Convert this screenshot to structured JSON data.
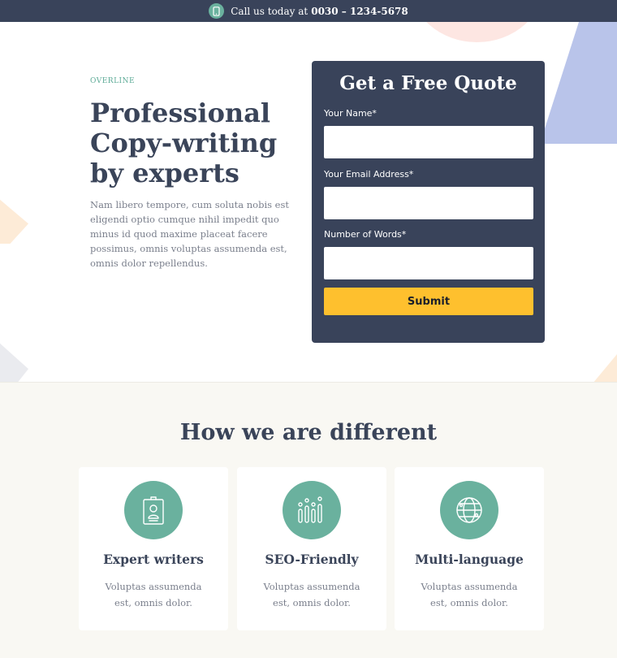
{
  "topbar": {
    "call_text": "Call us today at",
    "phone_number": "0030 – 1234-5678",
    "icon": "phone-icon"
  },
  "hero": {
    "overline": "OVERLINE",
    "title": "Professional Copy-writing by experts",
    "text": "Nam libero tempore, cum soluta nobis est eligendi optio cumque nihil impedit quo minus id quod maxime placeat facere possimus, omnis voluptas assumenda est, omnis dolor repellendus."
  },
  "quote_form": {
    "title": "Get a Free Quote",
    "fields": [
      {
        "label": "Your Name*",
        "value": "",
        "placeholder": ""
      },
      {
        "label": "Your Email Address*",
        "value": "",
        "placeholder": ""
      },
      {
        "label": "Number of Words*",
        "value": "",
        "placeholder": ""
      }
    ],
    "submit_label": "Submit"
  },
  "features": {
    "title": "How we are different",
    "cards": [
      {
        "icon": "id-badge-icon",
        "title": "Expert writers",
        "text": "Voluptas assumenda est, omnis dolor."
      },
      {
        "icon": "bar-chart-icon",
        "title": "SEO-Friendly",
        "text": "Voluptas assumenda est, omnis dolor."
      },
      {
        "icon": "globe-icon",
        "title": "Multi-language",
        "text": "Voluptas assumenda est, omnis dolor."
      }
    ]
  },
  "colors": {
    "navy": "#39435a",
    "accent_green": "#6ab19e",
    "button_yellow": "#fec02e",
    "section_bg": "#f9f8f3"
  }
}
